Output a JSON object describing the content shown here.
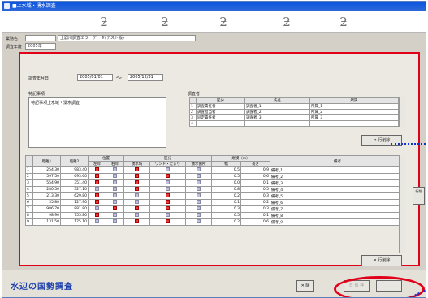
{
  "window": {
    "title": "■上水域・湧水調査"
  },
  "header": {
    "business_name_label": "業務名",
    "business_name_value": "",
    "business_name_text": "土器川調査エラーデータ(テスト版)",
    "year_label": "調査年度",
    "year_value": "2005年"
  },
  "survey": {
    "date_label": "調査年月日",
    "date_from": "2005/01/01",
    "tilde": "～",
    "date_to": "2005/12/31"
  },
  "notes": {
    "label": "特記事項",
    "value": "特記事項上水域・湧水調査"
  },
  "surveyors": {
    "label": "調査者",
    "columns": [
      "区分",
      "氏名",
      "所属"
    ],
    "rows": [
      {
        "no": "1",
        "kubun": "調査責任者",
        "name": "調査者_1",
        "org": "所属_1"
      },
      {
        "no": "2",
        "kubun": "調査担当者",
        "name": "調査者_2",
        "org": "所属_2"
      },
      {
        "no": "3",
        "kubun": "同定責任者",
        "name": "調査者_3",
        "org": "所属_3"
      },
      {
        "no": "4",
        "kubun": "",
        "name": "",
        "org": ""
      }
    ],
    "delete_row_label": "行削除"
  },
  "main_table": {
    "headers": {
      "dist1": "距離1",
      "dist2": "距離2",
      "position": "位置",
      "left": "左岸",
      "right": "右岸",
      "kubun": "区分",
      "jousui": "湧水域",
      "wando": "ワンド・たまり",
      "yuusui": "湧水箇所",
      "scale": "規模（m）",
      "width": "幅",
      "length": "長さ",
      "remarks": "備考"
    },
    "rows": [
      {
        "no": "1",
        "d1": "254.30",
        "d2": "983.40",
        "l": true,
        "r": false,
        "a": true,
        "b": false,
        "c": false,
        "w": "0.5",
        "len": "0.9",
        "rem": "備考_1"
      },
      {
        "no": "2",
        "d1": "597.50",
        "d2": "693.60",
        "l": true,
        "r": false,
        "a": true,
        "b": true,
        "c": false,
        "w": "0.5",
        "len": "0.6",
        "rem": "備考_2"
      },
      {
        "no": "3",
        "d1": "554.90",
        "d2": "351.40",
        "l": true,
        "r": false,
        "a": true,
        "b": false,
        "c": false,
        "w": "0.0",
        "len": "0.1",
        "rem": "備考_3"
      },
      {
        "no": "4",
        "d1": "280.50",
        "d2": "327.10",
        "l": false,
        "r": false,
        "a": true,
        "b": false,
        "c": false,
        "w": "0.8",
        "len": "0.5",
        "rem": "備考_4"
      },
      {
        "no": "5",
        "d1": "213.30",
        "d2": "629.80",
        "l": true,
        "r": false,
        "a": false,
        "b": true,
        "c": false,
        "w": "0.2",
        "len": "0.3",
        "rem": "備考_5"
      },
      {
        "no": "6",
        "d1": "35.80",
        "d2": "127.90",
        "l": true,
        "r": false,
        "a": false,
        "b": true,
        "c": false,
        "w": "0.1",
        "len": "0.2",
        "rem": "備考_6"
      },
      {
        "no": "7",
        "d1": "986.70",
        "d2": "881.80",
        "l": false,
        "r": true,
        "a": true,
        "b": true,
        "c": false,
        "w": "0.3",
        "len": "0.3",
        "rem": "備考_7"
      },
      {
        "no": "8",
        "d1": "98.90",
        "d2": "755.80",
        "l": true,
        "r": false,
        "a": false,
        "b": false,
        "c": false,
        "w": "0.5",
        "len": "0.1",
        "rem": "備考_8"
      },
      {
        "no": "9",
        "d1": "131.50",
        "d2": "175.10",
        "l": false,
        "r": false,
        "a": true,
        "b": true,
        "c": false,
        "w": "0.2",
        "len": "0.6",
        "rem": "備考_9"
      }
    ],
    "delete_row_label": "行削除"
  },
  "bottom": {
    "logo": "水辺の国勢調査",
    "delete_label": "除",
    "btn2_label": "日 保 存",
    "btn3_label": ""
  },
  "side": {
    "label": "行削"
  },
  "colors": {
    "highlight": "#e0001a",
    "arrow": "#1030d0",
    "check_on": "#e63a3a"
  }
}
